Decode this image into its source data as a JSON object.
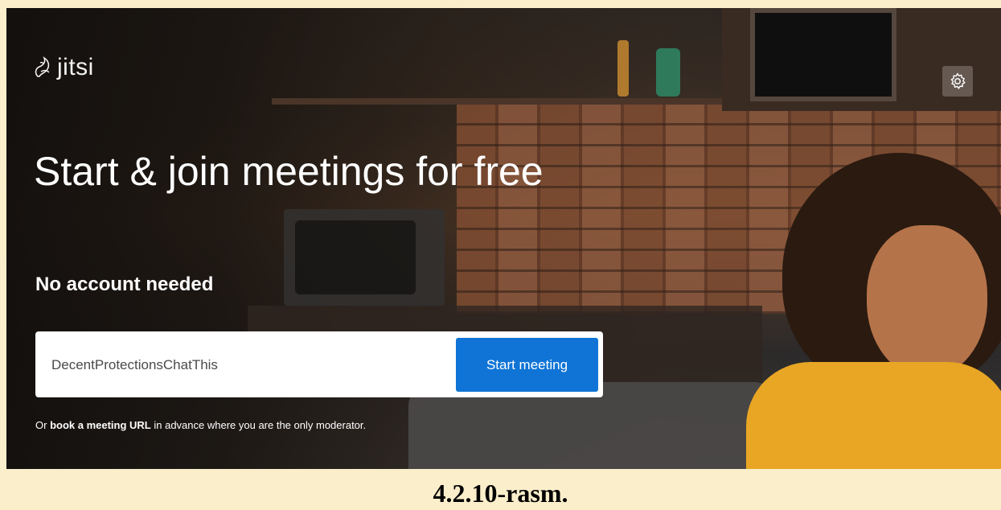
{
  "header": {
    "logo_text": "jitsi",
    "logo_icon": "jitsi-logo-icon",
    "settings_icon": "gear-icon"
  },
  "hero": {
    "headline": "Start & join meetings for free",
    "subheadline": "No account needed"
  },
  "join": {
    "room_name_value": "DecentProtectionsChatThis",
    "start_button_label": "Start meeting"
  },
  "note": {
    "prefix": "Or ",
    "link_text": "book a meeting URL",
    "suffix": " in advance where you are the only moderator."
  },
  "caption": "4.2.10-rasm.",
  "colors": {
    "accent": "#0f74d6",
    "caption_background": "#fbeecb"
  }
}
